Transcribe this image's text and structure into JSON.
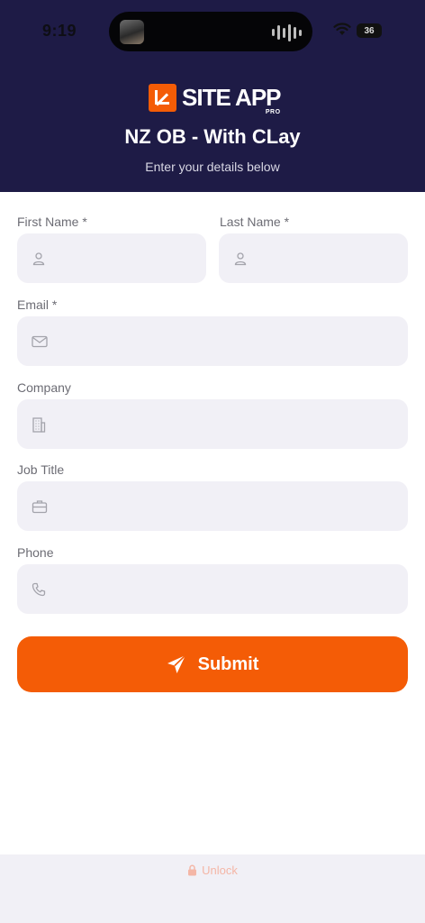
{
  "status_bar": {
    "time": "9:19",
    "battery": "36"
  },
  "header": {
    "logo_text": "SITE APP",
    "logo_sub": "PRO",
    "title": "NZ OB - With CLay",
    "subtitle": "Enter your details below"
  },
  "form": {
    "first_name_label": "First Name *",
    "last_name_label": "Last Name *",
    "email_label": "Email *",
    "company_label": "Company",
    "job_title_label": "Job Title",
    "phone_label": "Phone"
  },
  "submit_label": "Submit",
  "footer": {
    "unlock_label": "Unlock"
  },
  "colors": {
    "accent": "#f45c06",
    "header_bg": "#1e1b46",
    "field_bg": "#f1f0f6"
  }
}
